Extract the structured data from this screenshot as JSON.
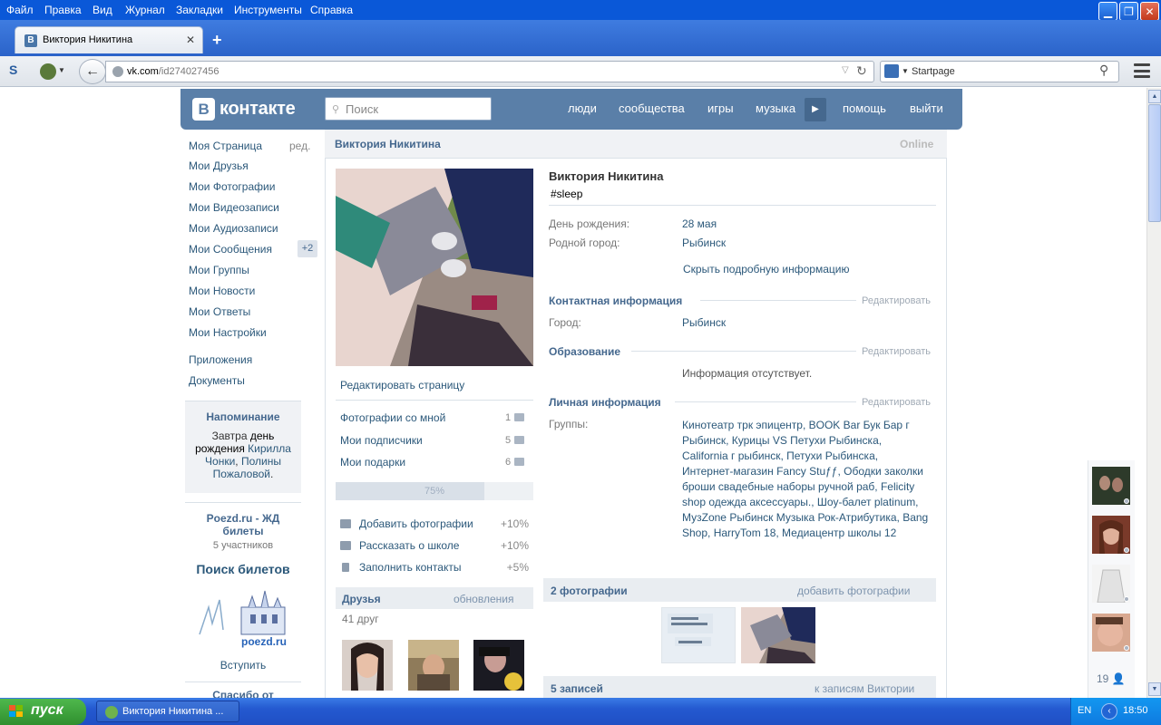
{
  "browser": {
    "menu": [
      "Файл",
      "Правка",
      "Вид",
      "Журнал",
      "Закладки",
      "Инструменты",
      "Справка"
    ],
    "tab_title": "Виктория Никитина",
    "tab_favicon": "В",
    "url_domain": "vk.com",
    "url_path": "/id274027456",
    "search_engine": "Startpage"
  },
  "vk": {
    "logo_text": "контакте",
    "logo_letter": "В",
    "search_placeholder": "Поиск",
    "nav": [
      "люди",
      "сообщества",
      "игры",
      "музыка",
      "помощь",
      "выйти"
    ],
    "left_menu": [
      "Моя Страница",
      "Мои Друзья",
      "Мои Фотографии",
      "Мои Видеозаписи",
      "Мои Аудиозаписи",
      "Мои Сообщения",
      "Мои Группы",
      "Мои Новости",
      "Мои Ответы",
      "Мои Настройки",
      "Приложения",
      "Документы"
    ],
    "left_edit": "ред.",
    "messages_badge": "+2",
    "reminder": {
      "title": "Напоминание",
      "t1": "Завтра ",
      "t2": "день рождения",
      "t3": " ",
      "n1": "Кириллa Чонки",
      "t4": ", ",
      "n2": "Полины Пожаловой",
      "t5": "."
    },
    "ad": {
      "title": "Poezd.ru - ЖД билеты",
      "members": "5 участников",
      "search": "Поиск билетов",
      "logo": "poezd.ru",
      "join": "Вступить",
      "more": "Спасибо от"
    }
  },
  "profile": {
    "header_name": "Виктория Никитина",
    "header_status": "Online",
    "name": "Виктория Никитина",
    "status": "#sleep",
    "edit_page": "Редактировать страницу",
    "counters": [
      {
        "label": "Фотографии со мной",
        "count": "1"
      },
      {
        "label": "Мои подписчики",
        "count": "5"
      },
      {
        "label": "Мои подарки",
        "count": "6"
      }
    ],
    "progress_text": "75%",
    "progress_value": 0.75,
    "tips": [
      {
        "label": "Добавить фотографии",
        "pct": "+10%"
      },
      {
        "label": "Рассказать о школе",
        "pct": "+10%"
      },
      {
        "label": "Заполнить контакты",
        "pct": "+5%"
      }
    ],
    "friends_title": "Друзья",
    "friends_updates": "обновления",
    "friends_count": "41 друг",
    "birthday_label": "День рождения:",
    "birthday": "28 мая",
    "hometown_label": "Родной город:",
    "hometown": "Рыбинск",
    "hide_info": "Скрыть подробную информацию",
    "contact_title": "Контактная информация",
    "edit_label": "Редактировать",
    "city_label": "Город:",
    "city": "Рыбинск",
    "edu_title": "Образование",
    "edu_none": "Информация отсутствует.",
    "personal_title": "Личная информация",
    "groups_label": "Группы:",
    "groups": "Кинотеатр трк эпицентр, BOOK Bar Бук Бар г Рыбинск, Курицы VS Петухи Рыбинска, California г рыбинск, Петухи Рыбинска, Интернет-магазин Fancy Stuƒƒ, Ободки заколки броши свадебные наборы ручной раб, Felicity shop одежда аксессуары., Шоу-балет platinum, МузZone Рыбинск Музыка Рок-Атрибутика, Bang Shop, HarryTom 18, Медиацентр школы 12",
    "photos_title": "2 фотографии",
    "photos_add": "добавить фотографии",
    "posts_title": "5 записей",
    "posts_link": "к записям Виктории"
  },
  "dock": {
    "count": "19"
  },
  "taskbar": {
    "start": "пуск",
    "task": "Виктория Никитина ...",
    "lang": "EN",
    "time": "18:50"
  }
}
